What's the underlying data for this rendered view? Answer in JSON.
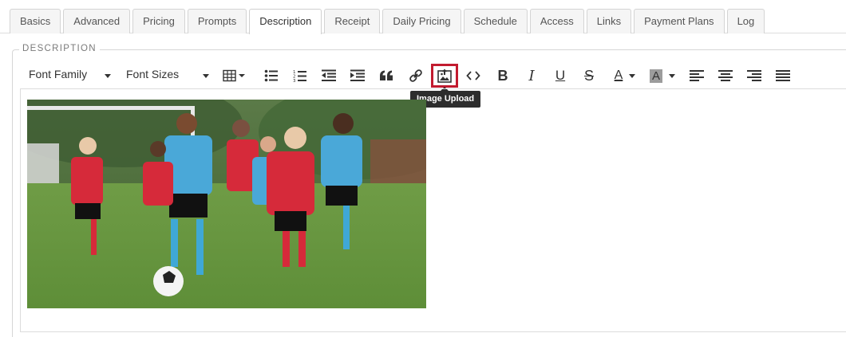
{
  "tabs": [
    {
      "label": "Basics"
    },
    {
      "label": "Advanced"
    },
    {
      "label": "Pricing"
    },
    {
      "label": "Prompts"
    },
    {
      "label": "Description",
      "active": true
    },
    {
      "label": "Receipt"
    },
    {
      "label": "Daily Pricing"
    },
    {
      "label": "Schedule"
    },
    {
      "label": "Access"
    },
    {
      "label": "Links"
    },
    {
      "label": "Payment Plans"
    },
    {
      "label": "Log"
    }
  ],
  "section": {
    "legend": "DESCRIPTION"
  },
  "toolbar": {
    "font_family_label": "Font Family",
    "font_sizes_label": "Font Sizes",
    "tooltip": "Image Upload",
    "highlighted": "image-upload-button",
    "icons": [
      "table-icon",
      "bullet-list-icon",
      "numbered-list-icon",
      "outdent-icon",
      "indent-icon",
      "quote-icon",
      "link-icon",
      "image-upload-icon",
      "code-icon",
      "bold-icon",
      "italic-icon",
      "underline-icon",
      "strikethrough-icon",
      "font-color-icon",
      "background-color-icon",
      "align-left-icon",
      "align-center-icon",
      "align-right-icon",
      "justify-icon"
    ],
    "glyphs": {
      "bold": "B",
      "italic": "I",
      "underline": "U",
      "strikethrough": "S",
      "font_color": "A",
      "background_color": "A"
    }
  },
  "editor": {
    "image": "photo of children playing soccer on a grass field"
  },
  "colors": {
    "accent_highlight": "#c21b2f",
    "tooltip_bg": "#2d2d2d"
  }
}
